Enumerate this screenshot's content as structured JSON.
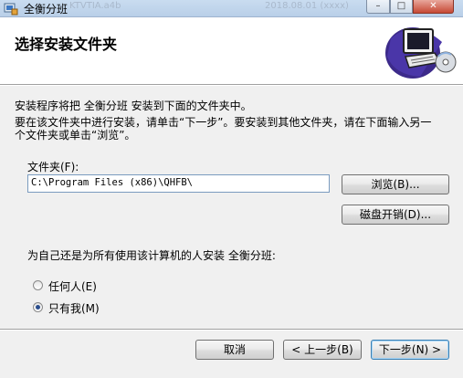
{
  "window": {
    "title": "全衡分班",
    "ghost_text_1": "KTVTIA.a4b",
    "ghost_text_2": "2018.08.01 (xxxx)",
    "min_icon": "minimize-icon",
    "max_icon": "maximize-icon",
    "close_icon": "close-icon"
  },
  "banner": {
    "title": "选择安装文件夹",
    "art_icon": "computer-install-icon"
  },
  "body": {
    "intro": "安装程序将把 全衡分班 安装到下面的文件夹中。",
    "instructions_line1": "要在该文件夹中进行安装，请单击“下一步”。要安装到其他文件夹，请在下面输入另一",
    "instructions_line2": "个文件夹或单击“浏览”。",
    "folder_label": "文件夹(F):",
    "folder_value": "C:\\Program Files (x86)\\QHFB\\",
    "browse_label": "浏览(B)...",
    "disk_cost_label": "磁盘开销(D)...",
    "install_for_question": "为自己还是为所有使用该计算机的人安装 全衡分班:",
    "radio_everyone": "任何人(E)",
    "radio_just_me": "只有我(M)",
    "selected": "just_me"
  },
  "footer": {
    "cancel_label": "取消",
    "prev_label": "< 上一步(B)",
    "next_label": "下一步(N) >"
  }
}
